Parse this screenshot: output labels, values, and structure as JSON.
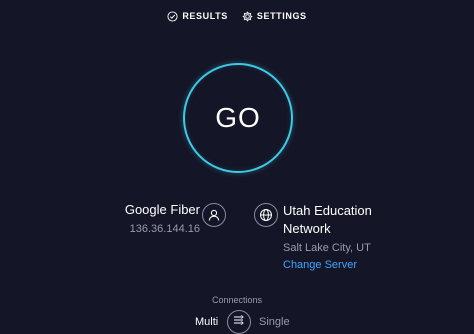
{
  "nav": {
    "results_label": "RESULTS",
    "results_icon": "check-circle-icon",
    "settings_label": "SETTINGS",
    "settings_icon": "gear-icon"
  },
  "go_button": {
    "label": "GO",
    "ring_color": "#3ec9e6"
  },
  "isp": {
    "name": "Google Fiber",
    "ip": "136.36.144.16",
    "icon": "user-icon"
  },
  "server": {
    "name_line1": "Utah Education",
    "name_line2": "Network",
    "location": "Salt Lake City, UT",
    "change_label": "Change Server",
    "icon": "globe-icon"
  },
  "connections": {
    "label": "Connections",
    "multi_label": "Multi",
    "single_label": "Single",
    "selected": "Multi",
    "toggle_icon": "connections-icon"
  },
  "colors": {
    "background": "#141526",
    "accent_cyan": "#3ec9e6",
    "link_blue": "#3ea6ff",
    "muted_text": "#9a9bb0"
  }
}
